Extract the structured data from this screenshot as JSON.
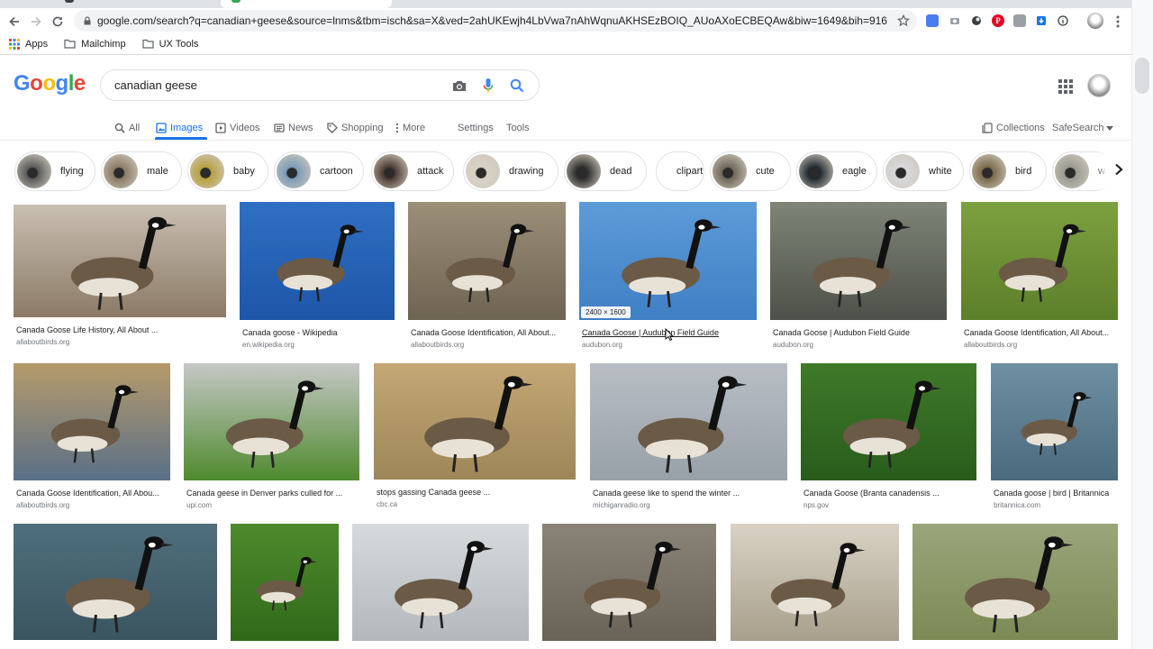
{
  "browser": {
    "url": "google.com/search?q=canadian+geese&source=lnms&tbm=isch&sa=X&ved=2ahUKEwjh4LbVwa7nAhWqnuAKHSEzBOIQ_AUoAXoECBEQAw&biw=1649&bih=916",
    "bookmarks": [
      {
        "label": "Apps",
        "icon": "apps-grid-icon"
      },
      {
        "label": "Mailchimp",
        "icon": "folder-icon"
      },
      {
        "label": "UX Tools",
        "icon": "folder-icon"
      }
    ]
  },
  "search": {
    "query": "canadian geese",
    "logo": [
      "G",
      "o",
      "o",
      "g",
      "l",
      "e"
    ],
    "logo_colors": [
      "#4285f4",
      "#ea4335",
      "#fbbc05",
      "#4285f4",
      "#34a853",
      "#ea4335"
    ]
  },
  "tabs": {
    "all": "All",
    "images": "Images",
    "videos": "Videos",
    "news": "News",
    "shopping": "Shopping",
    "more": "More",
    "settings": "Settings",
    "tools": "Tools",
    "collections": "Collections",
    "safesearch": "SafeSearch"
  },
  "chips": [
    "flying",
    "male",
    "baby",
    "cartoon",
    "attack",
    "drawing",
    "dead",
    "clipart",
    "cute",
    "eagle",
    "white",
    "bird",
    "wa"
  ],
  "results": [
    {
      "title": "Canada Goose Life History, All About ...",
      "source": "allaboutbirds.org",
      "bg": [
        "#c9bfb2",
        "#8b7a66"
      ]
    },
    {
      "title": "Canada goose - Wikipedia",
      "source": "en.wikipedia.org",
      "bg": [
        "#2f6fc2",
        "#1e56a8"
      ]
    },
    {
      "title": "Canada Goose Identification, All About...",
      "source": "allaboutbirds.org",
      "bg": [
        "#9c8f78",
        "#6e6452"
      ]
    },
    {
      "title": "Canada Goose | Audubon Field Guide",
      "source": "audubon.org",
      "bg": [
        "#5d9bd8",
        "#3f7fc4"
      ],
      "badge": "2400 × 1600"
    },
    {
      "title": "Canada Goose | Audubon Field Guide",
      "source": "audubon.org",
      "bg": [
        "#7f8478",
        "#4d5149"
      ]
    },
    {
      "title": "Canada Goose Identification, All About...",
      "source": "allaboutbirds.org",
      "bg": [
        "#7da03f",
        "#5c7f2a"
      ]
    },
    {
      "title": "Canada Goose Identification, All Abou...",
      "source": "allaboutbirds.org",
      "bg": [
        "#b59b6a",
        "#5a6f88"
      ]
    },
    {
      "title": "Canada geese in Denver parks culled for ...",
      "source": "upi.com",
      "bg": [
        "#c6c8c6",
        "#4f8a2e"
      ]
    },
    {
      "title": "stops gassing Canada geese ...",
      "source": "cbc.ca",
      "bg": [
        "#c4a775",
        "#9e8658"
      ]
    },
    {
      "title": "Canada geese like to spend the winter ...",
      "source": "michiganradio.org",
      "bg": [
        "#b8bec4",
        "#98a0a8"
      ]
    },
    {
      "title": "Canada Goose (Branta canadensis ...",
      "source": "nps.gov",
      "bg": [
        "#3f7a2a",
        "#295c1c"
      ]
    },
    {
      "title": "Canada goose | bird | Britannica",
      "source": "britannica.com",
      "bg": [
        "#6f8fa3",
        "#4b6a7e"
      ]
    },
    {
      "title": "",
      "source": "",
      "bg": [
        "#4f6f7c",
        "#3a5560"
      ]
    },
    {
      "title": "",
      "source": "",
      "bg": [
        "#4e8a2c",
        "#2f6a1a"
      ]
    },
    {
      "title": "",
      "source": "",
      "bg": [
        "#d6dadd",
        "#b2b8bc"
      ]
    },
    {
      "title": "",
      "source": "",
      "bg": [
        "#8a8478",
        "#6a6458"
      ]
    },
    {
      "title": "",
      "source": "",
      "bg": [
        "#d9d2c4",
        "#a89f8c"
      ]
    },
    {
      "title": "",
      "source": "",
      "bg": [
        "#9aa57a",
        "#7b8a55"
      ]
    }
  ],
  "colors": {
    "accent": "#1a73e8",
    "link_hover_underline": "#202124"
  }
}
